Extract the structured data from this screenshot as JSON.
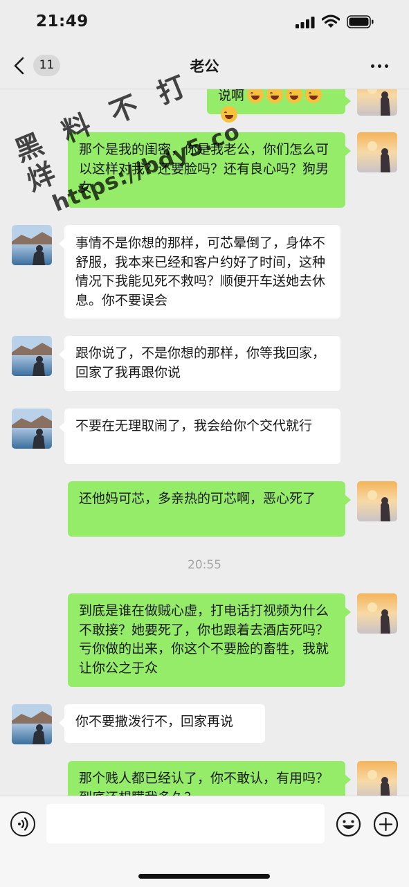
{
  "status_bar": {
    "time": "21:49"
  },
  "nav": {
    "unread_count": "11",
    "title": "老公"
  },
  "watermark": {
    "line1": "黑 料 不 打 烊",
    "line2": "https://bdy5.co"
  },
  "messages": [
    {
      "side": "me",
      "text": "说啊"
    },
    {
      "side": "me",
      "text": "那个是我的闺密，你是我老公，你们怎么可以这样对我？还要脸吗？还有良心吗？狗男女"
    },
    {
      "side": "other",
      "text": "事情不是你想的那样，可芯晕倒了，身体不舒服，我本来已经和客户约好了时间，这种情况下我能见死不救吗？顺便开车送她去休息。你不要误会"
    },
    {
      "side": "other",
      "text": "跟你说了，不是你想的那样，你等我回家，回家了我再跟你说"
    },
    {
      "side": "other",
      "text": "不要在无理取闹了，我会给你个交代就行"
    },
    {
      "side": "me",
      "text": "还他妈可芯，多亲热的可芯啊，恶心死了"
    },
    {
      "side": "me",
      "text": "到底是谁在做贼心虚，打电话打视频为什么不敢接？她要死了，你也跟着去酒店死吗？亏你做的出来，你这个不要脸的畜牲，我就让你公之于众"
    },
    {
      "side": "other",
      "text": "你不要撒泼行不，回家再说"
    },
    {
      "side": "me",
      "text": "那个贱人都已经认了，你不敢认，有用吗？到底还想瞒我多久？"
    }
  ],
  "timestamp": "20:55",
  "emoji_icons": [
    "laughing-face-icon",
    "laughing-face-icon",
    "laughing-face-icon",
    "laughing-face-icon",
    "laughing-face-icon"
  ],
  "colors": {
    "my_bubble": "#95ec69",
    "other_bubble": "#ffffff",
    "background": "#ededed"
  }
}
